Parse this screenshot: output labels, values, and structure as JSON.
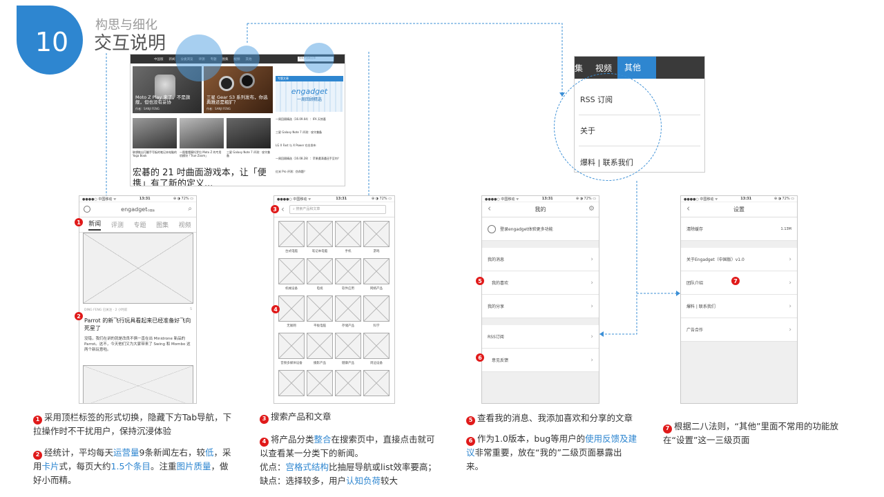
{
  "header": {
    "number": "10",
    "subtitle": "构思与细化",
    "title": "交互说明"
  },
  "website": {
    "nav": [
      "中国版",
      "新闻",
      "分类浏览",
      "评测",
      "专题",
      "图集",
      "视频",
      "其他"
    ],
    "search_placeholder": "搜索产品和文章",
    "cards": [
      {
        "title": "Moto Z Play 来了，不是旗舰，但也没有妥协",
        "author": "作者：SANJI FENG"
      },
      {
        "title": "三星 Gear S3 系列发布，你选典雅还是粗犷？",
        "author": "作者：SANJI FENG"
      }
    ],
    "small_cards": [
      "联想推出可翻手写板的笔记本电脑的 Yoga Book",
      "一图看懂摩托罗拉 Moto Z 的专用机模块「True Zoom」",
      "三星 Galaxy Note 7 评测：攻守兼备"
    ],
    "headline": "宏碁的 21 吋曲面游戏本，让「便携」有了新的定义...",
    "sidebar_header": "专题文章",
    "sidebar_logo": "engadget",
    "sidebar_logo_sub": "一周回顾精选",
    "sidebar_items": [
      "一周回顾精选（16.09.04）：IFA 天惊喜",
      "三星 Galaxy Note 7 评测：攻守兼备",
      "LG X Fast 与 X Power 在台发布",
      "一周回顾精选（16.08.28）：苹果遭滴遇还手至何？",
      "红米 Pro 评测：伪命题？"
    ]
  },
  "menu": {
    "tabs": [
      "集",
      "视频",
      "其他"
    ],
    "items": [
      "RSS 订阅",
      "关于",
      "爆料 | 联系我们"
    ]
  },
  "status": {
    "carrier": "●●●●○ 中国移动 ᯤ",
    "time": "13:31",
    "battery": "⊕ ◑ 72% ▭"
  },
  "phone1": {
    "logo": "engadget",
    "logo_sub": "中国版",
    "tabs": [
      "新闻",
      "评测",
      "专题",
      "图集",
      "视频"
    ],
    "meta": "DING FENG 已关注 · 2 小时前",
    "meta_count": "5",
    "title": "Parrot 的新飞行玩具看起来已经准备好飞向死星了",
    "desc": "没错，我们在讲的就是改良不俩一直在出 Minidrone 新品的 Parrot。这不，今天他们又为大家带来了 Swing 和 Mombo 这两个新玩意啦。"
  },
  "phone2": {
    "search_placeholder": "搜索产品和文章",
    "categories": [
      "台式电脑",
      "笔记本电脑",
      "手机",
      "游戏",
      "机械设备",
      "电视",
      "软件应用",
      "网络产品",
      "无联网",
      "平板电脑",
      "存储产品",
      "科学",
      "音频多媒体设备",
      "摄影产品",
      "健康产品",
      "周边设备",
      "",
      "",
      "",
      ""
    ]
  },
  "phone3": {
    "title": "我的",
    "login": "登录engadget体验更多功能",
    "rows": [
      "我的消息",
      "我的喜欢",
      "我的分享",
      "RSS订阅",
      "意见反馈"
    ]
  },
  "phone4": {
    "title": "设置",
    "rows": [
      {
        "label": "清除缓存",
        "value": "1.13M"
      },
      {
        "label": "关于Engadget（中国版）v1.0",
        "value": ""
      },
      {
        "label": "团队介绍",
        "value": ""
      },
      {
        "label": "爆料 | 联系我们",
        "value": ""
      },
      {
        "label": "广告合作",
        "value": ""
      }
    ]
  },
  "markers": [
    "1",
    "2",
    "3",
    "4",
    "5",
    "6",
    "7"
  ],
  "notes": {
    "n1": "采用顶栏标签的形式切换，隐藏下方Tab导航，下拉操作时不干扰用户，保持沉浸体验",
    "n2_a": "经统计，平均每天",
    "n2_b": "运营量",
    "n2_c": "9条新闻左右，较",
    "n2_d": "低",
    "n2_e": "，采用",
    "n2_f": "卡片",
    "n2_g": "式，每页大约",
    "n2_h": "1.5个条目",
    "n2_i": "。注重",
    "n2_j": "图片质量",
    "n2_k": "，做好小而精。",
    "n3": "搜索产品和文章",
    "n4_a": "将产品分类",
    "n4_b": "整合",
    "n4_c": "在搜索页中，直接点击就可以查看某一分类下的新闻。",
    "n4_d": "优点：",
    "n4_e": "宫格式结构",
    "n4_f": "比抽屉导航或list效率要高；缺点：选择较多，用户",
    "n4_g": "认知负荷",
    "n4_h": "较大",
    "n5": "查看我的消息、我添加喜欢和分享的文章",
    "n6_a": "作为1.0版本，bug等用户的",
    "n6_b": "使用反馈及建议",
    "n6_c": "非常重要，放在“我的”二级页面暴露出来。",
    "n7": "根据二八法则，“其他”里面不常用的功能放在“设置”这一三级页面"
  }
}
